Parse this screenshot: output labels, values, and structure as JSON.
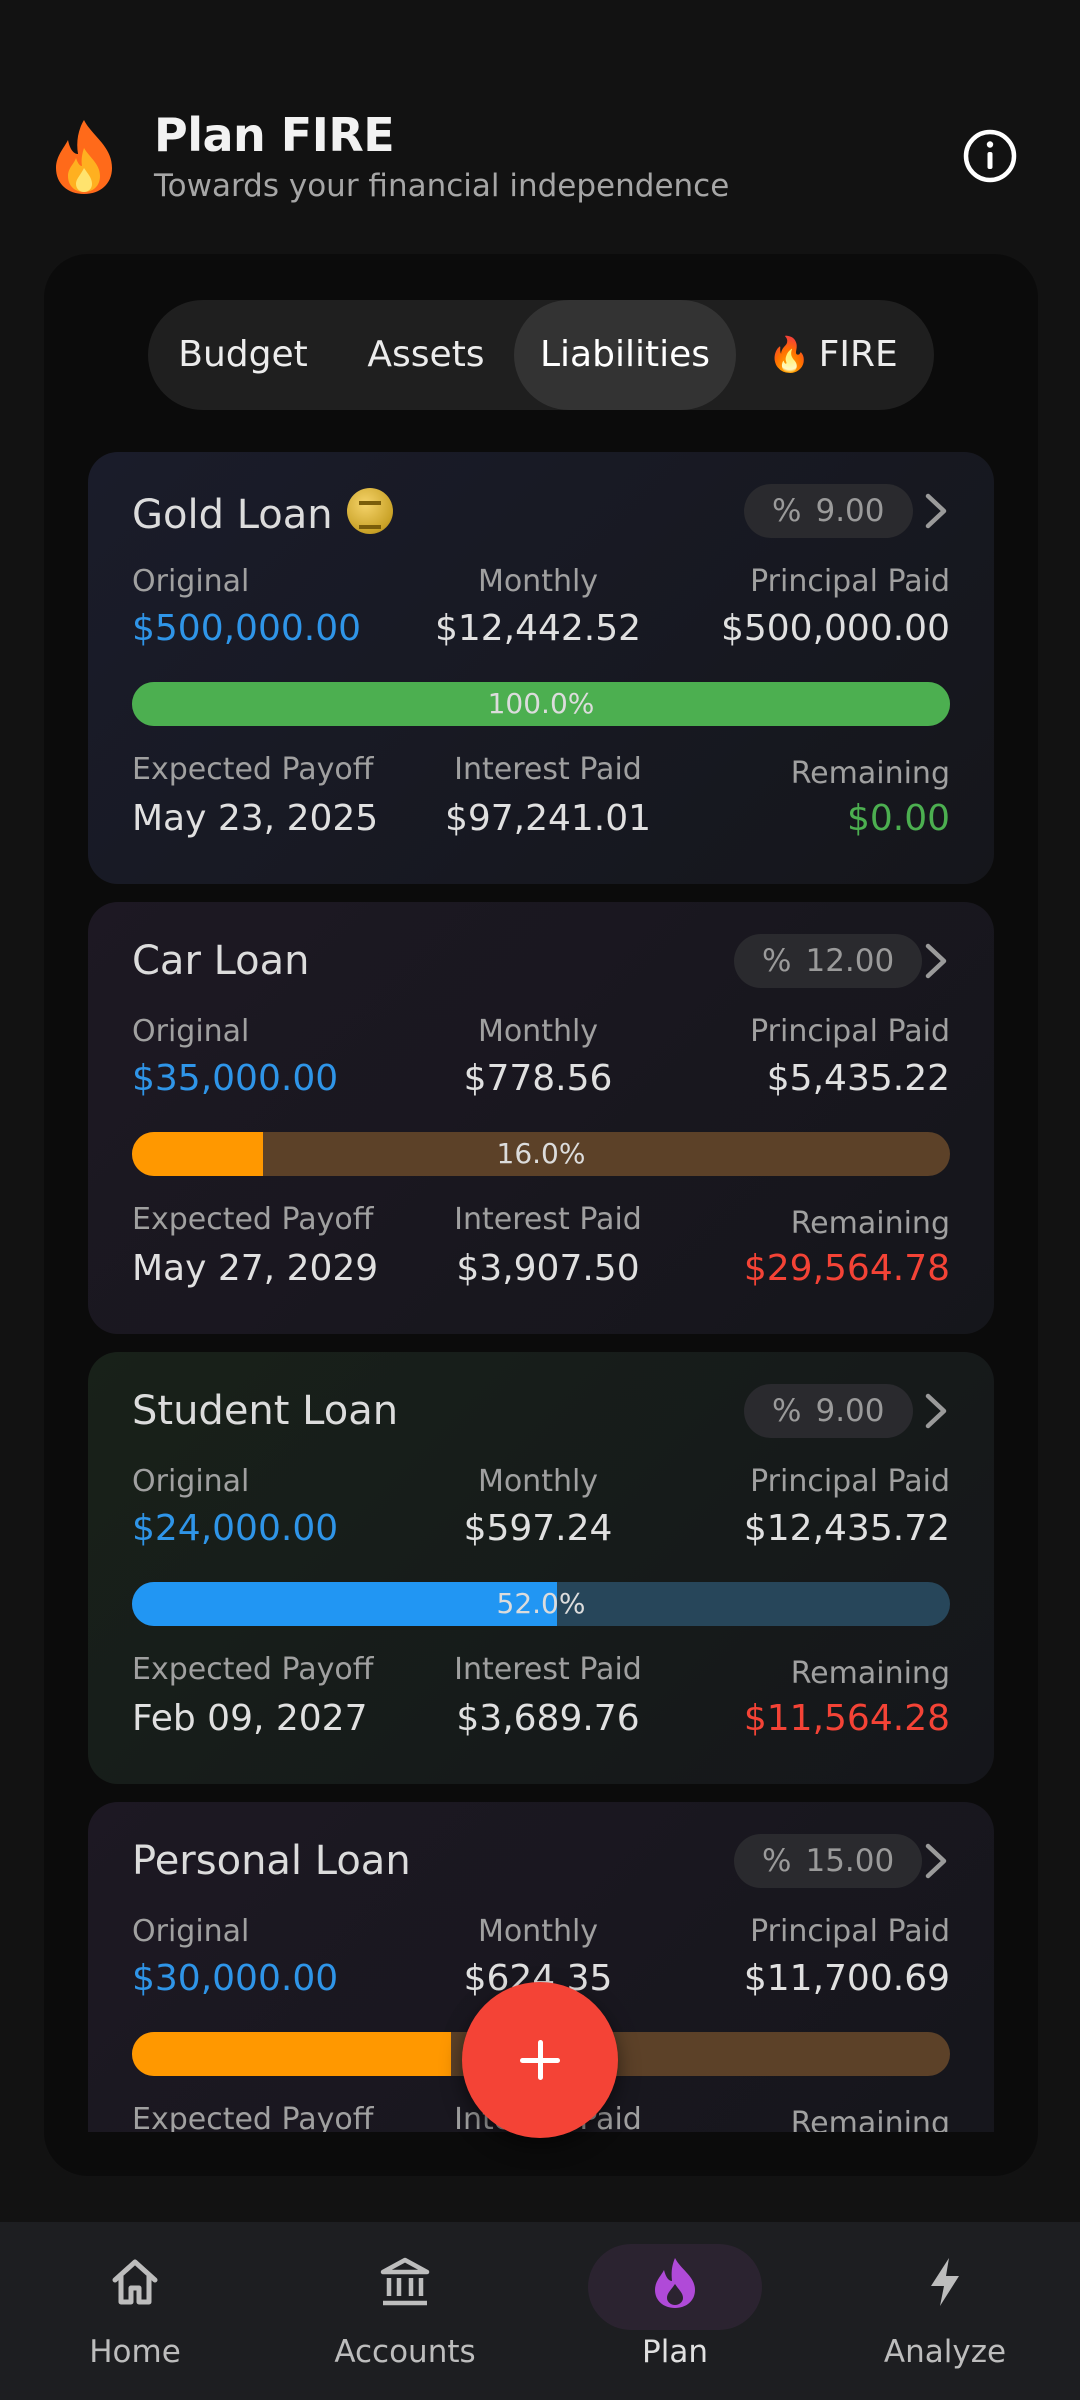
{
  "header": {
    "title": "Plan FIRE",
    "subtitle": "Towards your financial independence",
    "flame_icon": "fire-emoji",
    "info_icon": "info-icon"
  },
  "tabs": [
    {
      "label": "Budget",
      "active": false
    },
    {
      "label": "Assets",
      "active": false
    },
    {
      "label": "Liabilities",
      "active": true
    },
    {
      "label": "FIRE",
      "emoji": "🔥",
      "active": false
    }
  ],
  "labels": {
    "original": "Original",
    "monthly": "Monthly",
    "principal_paid": "Principal Paid",
    "expected_payoff": "Expected Payoff",
    "interest_paid": "Interest Paid",
    "remaining": "Remaining",
    "pct_symbol": "%"
  },
  "loans": [
    {
      "name": "Gold Loan",
      "rate": "9.00",
      "original": "$500,000.00",
      "monthly": "$12,442.52",
      "principal_paid": "$500,000.00",
      "progress_text": "100.0%",
      "progress": 1.0,
      "bar_color": "#4caf50",
      "bar_track": "#2e5a30",
      "expected_payoff": "May 23, 2025",
      "interest_paid": "$97,241.01",
      "remaining": "$0.00",
      "remaining_status": "green",
      "bg": "#1a1c2a"
    },
    {
      "name": "Car Loan",
      "rate": "12.00",
      "original": "$35,000.00",
      "monthly": "$778.56",
      "principal_paid": "$5,435.22",
      "progress_text": "16.0%",
      "progress": 0.16,
      "bar_color": "#ff9800",
      "bar_track": "#5c4128",
      "expected_payoff": "May 27, 2029",
      "interest_paid": "$3,907.50",
      "remaining": "$29,564.78",
      "remaining_status": "red",
      "bg": "#1d1823"
    },
    {
      "name": "Student Loan",
      "rate": "9.00",
      "original": "$24,000.00",
      "monthly": "$597.24",
      "principal_paid": "$12,435.72",
      "progress_text": "52.0%",
      "progress": 0.52,
      "bar_color": "#2196f3",
      "bar_track": "#27465a",
      "expected_payoff": "Feb 09, 2027",
      "interest_paid": "$3,689.76",
      "remaining": "$11,564.28",
      "remaining_status": "red",
      "bg": "#182119"
    },
    {
      "name": "Personal Loan",
      "rate": "15.00",
      "original": "$30,000.00",
      "monthly": "$624.35",
      "principal_paid": "$11,700.69",
      "progress_text": "",
      "progress": 0.39,
      "bar_color": "#ff9800",
      "bar_track": "#5c4128",
      "expected_payoff": "",
      "interest_paid": "",
      "remaining": "",
      "remaining_status": "red",
      "bg": "#1d1823"
    }
  ],
  "fab": {
    "icon": "plus-icon"
  },
  "nav": [
    {
      "label": "Home",
      "icon": "home-icon",
      "active": false
    },
    {
      "label": "Accounts",
      "icon": "bank-icon",
      "active": false
    },
    {
      "label": "Plan",
      "icon": "fire-icon",
      "active": true
    },
    {
      "label": "Analyze",
      "icon": "bolt-icon",
      "active": false
    }
  ],
  "colors": {
    "accent_blue": "#2f95e8",
    "positive": "#4caf50",
    "negative": "#f44336",
    "fab": "#f44336",
    "plan_active": "#b04ad8"
  }
}
